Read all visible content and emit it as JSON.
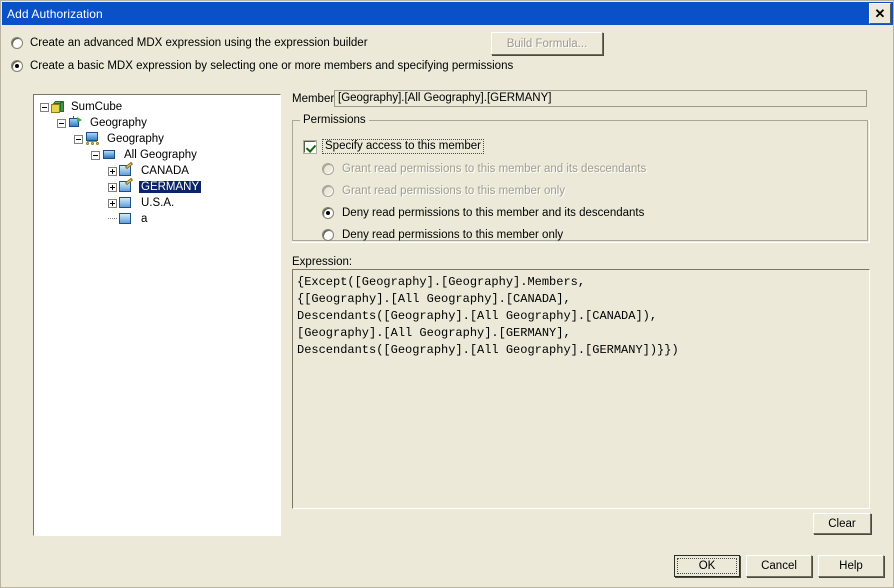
{
  "window": {
    "title": "Add Authorization",
    "close_label": "✕"
  },
  "options": {
    "advanced": {
      "label_pre": "Create an ",
      "label_accel": "a",
      "label_post": "dvanced MDX expression using the expression builder",
      "full": "Create an advanced MDX expression using the expression builder",
      "selected": false
    },
    "basic": {
      "full": "Create a basic MDX expression by selecting one or more members and specifying permissions",
      "selected": true
    },
    "build_formula_button": "Build Formula..."
  },
  "tree": {
    "nodes": [
      {
        "label": "SumCube",
        "depth": 0,
        "expander": "minus",
        "icon": "cube-icon",
        "selected": false
      },
      {
        "label": "Geography",
        "depth": 1,
        "expander": "minus",
        "icon": "dimension-icon",
        "selected": false
      },
      {
        "label": "Geography",
        "depth": 2,
        "expander": "minus",
        "icon": "hierarchy-icon",
        "selected": false
      },
      {
        "label": "All Geography",
        "depth": 3,
        "expander": "minus",
        "icon": "level-icon",
        "selected": false
      },
      {
        "label": "CANADA",
        "depth": 4,
        "expander": "plus",
        "icon": "member-edit-icon",
        "selected": false
      },
      {
        "label": "GERMANY",
        "depth": 4,
        "expander": "plus",
        "icon": "member-edit-icon",
        "selected": true
      },
      {
        "label": "U.S.A.",
        "depth": 4,
        "expander": "plus",
        "icon": "member-icon",
        "selected": false
      },
      {
        "label": "a",
        "depth": 4,
        "expander": "none",
        "icon": "member-icon",
        "selected": false
      }
    ]
  },
  "member": {
    "label": "Member:",
    "value": "[Geography].[All Geography].[GERMANY]"
  },
  "permissions": {
    "group_title": "Permissions",
    "specify_access": {
      "label": "Specify access to this member",
      "checked": true
    },
    "options": [
      {
        "label": "Grant read permissions to this member and its descendants",
        "selected": false,
        "disabled": true
      },
      {
        "label": "Grant read permissions to this member only",
        "selected": false,
        "disabled": true
      },
      {
        "label": "Deny read permissions to this member and its descendants",
        "selected": true,
        "disabled": false
      },
      {
        "label": "Deny read permissions to this member only",
        "selected": false,
        "disabled": false
      }
    ]
  },
  "expression": {
    "label": "Expression:",
    "lines": [
      "{Except([Geography].[Geography].Members,",
      "{[Geography].[All Geography].[CANADA],",
      "Descendants([Geography].[All Geography].[CANADA]),",
      "[Geography].[All Geography].[GERMANY],",
      "Descendants([Geography].[All Geography].[GERMANY])}})"
    ],
    "clear_button": "Clear"
  },
  "footer": {
    "ok": "OK",
    "cancel": "Cancel",
    "help": "Help"
  },
  "colors": {
    "titlebar": "#0A50C8",
    "dialog_bg": "#ECE9D8",
    "selection": "#0A246A",
    "tree_bg": "#FFFFFF"
  }
}
